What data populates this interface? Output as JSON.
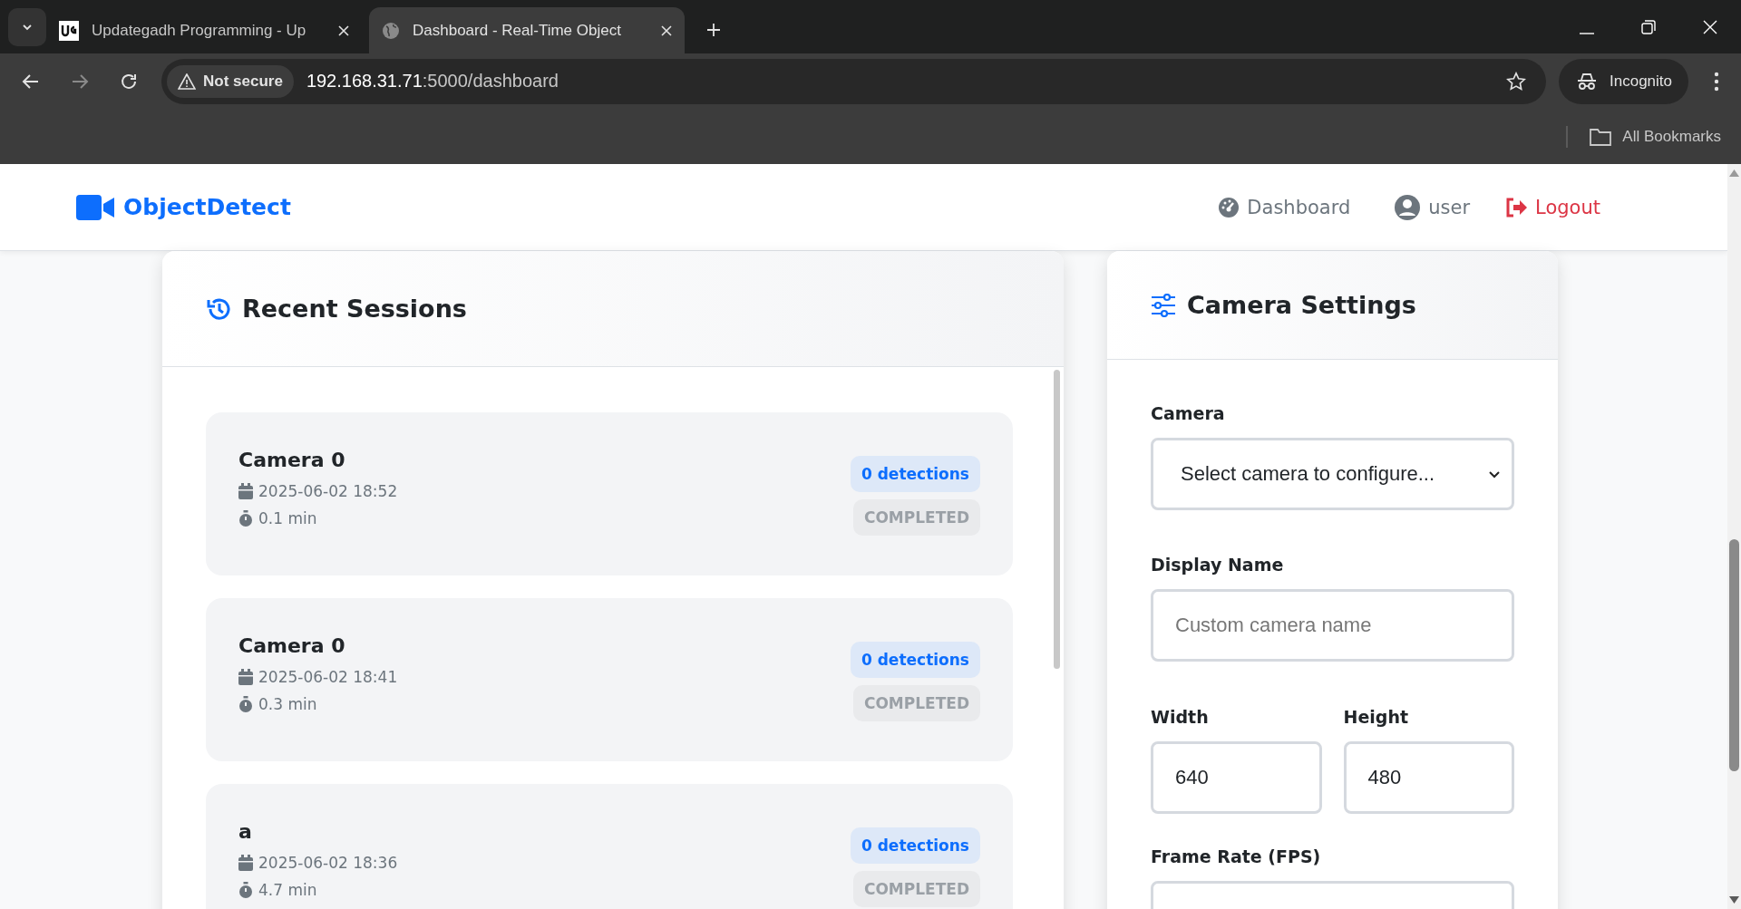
{
  "browser": {
    "tabs": [
      {
        "title": "Updategadh Programming - Up",
        "selected": false
      },
      {
        "title": "Dashboard - Real-Time Object",
        "selected": true
      }
    ],
    "address": {
      "security": "Not secure",
      "host": "192.168.31.71",
      "path": ":5000/dashboard"
    },
    "profile": "Incognito",
    "bookmarks": "All Bookmarks"
  },
  "navbar": {
    "brand": "ObjectDetect",
    "links": [
      {
        "label": "Dashboard",
        "kind": "dashboard"
      },
      {
        "label": "user",
        "kind": "user"
      },
      {
        "label": "Logout",
        "kind": "logout"
      }
    ]
  },
  "sessions": {
    "title": "Recent Sessions",
    "items": [
      {
        "camera": "Camera 0",
        "date": "2025-06-02 18:52",
        "duration": "0.1 min",
        "detections": "0 detections",
        "status": "COMPLETED"
      },
      {
        "camera": "Camera 0",
        "date": "2025-06-02 18:41",
        "duration": "0.3 min",
        "detections": "0 detections",
        "status": "COMPLETED"
      },
      {
        "camera": "a",
        "date": "2025-06-02 18:36",
        "duration": "4.7 min",
        "detections": "0 detections",
        "status": "COMPLETED"
      }
    ]
  },
  "settings": {
    "title": "Camera Settings",
    "fields": [
      {
        "kind": "select",
        "label": "Camera",
        "value": "Select camera to configure..."
      },
      {
        "kind": "text",
        "label": "Display Name",
        "placeholder": "Custom camera name"
      },
      {
        "kind": "pair",
        "items": [
          {
            "label": "Width",
            "value": "640"
          },
          {
            "label": "Height",
            "value": "480"
          }
        ]
      },
      {
        "kind": "number",
        "label": "Frame Rate (FPS)"
      }
    ]
  }
}
